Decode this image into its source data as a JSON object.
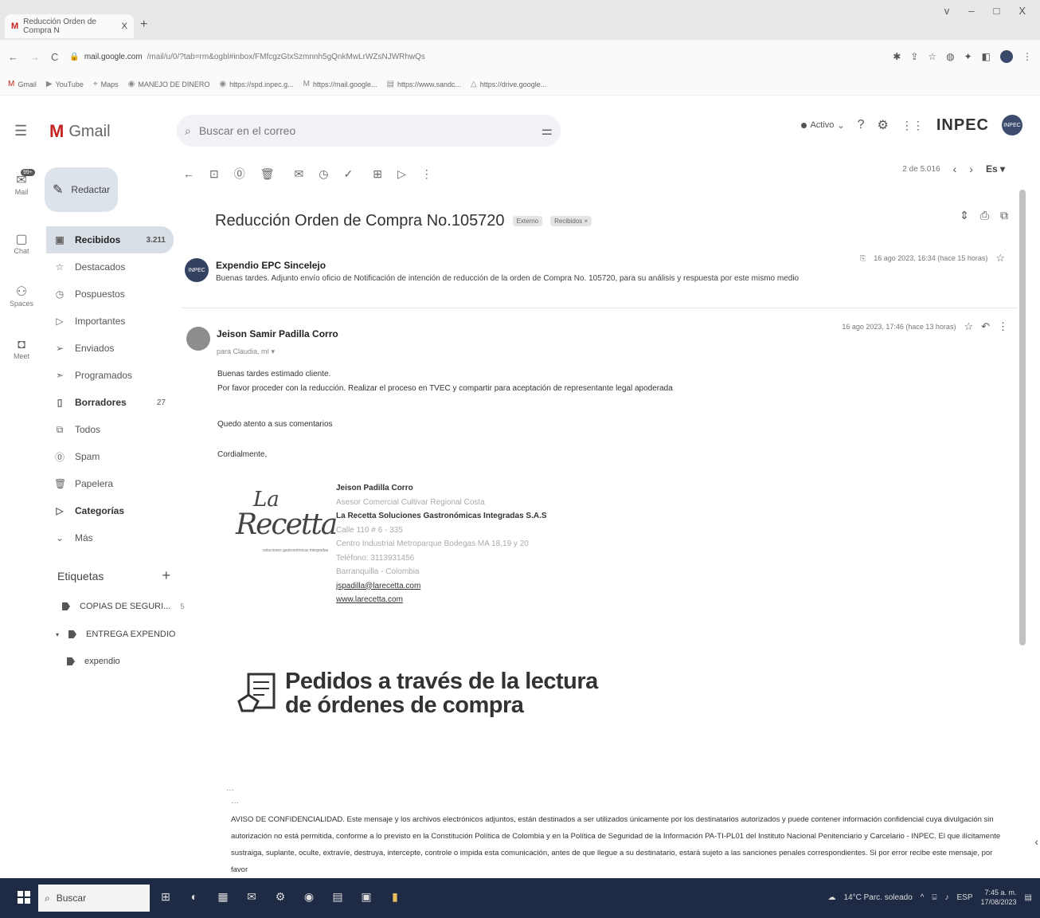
{
  "browser": {
    "tab_title": "Reducción Orden de Compra N",
    "tab_close": "X",
    "new_tab": "+",
    "window_controls": [
      "v",
      "–",
      "□",
      "X"
    ],
    "url_host": "mail.google.com",
    "url_rest": "/mail/u/0/?tab=rm&ogbl#inbox/FMfcgzGtxSzmnnh5gQnkMwLrWZsNJWRhwQs",
    "bookmarks": [
      "Gmail",
      "YouTube",
      "Maps",
      "MANEJO DE DINERO",
      "https://spd.inpec.g...",
      "https://mail.google...",
      "https://www.sandc...",
      "https://drive.google..."
    ]
  },
  "header": {
    "app_name": "Gmail",
    "search_placeholder": "Buscar en el correo",
    "status": "Activo",
    "org_logo": "INPEC"
  },
  "rail": {
    "mail_badge": "99+",
    "items": [
      "Mail",
      "Chat",
      "Spaces",
      "Meet"
    ]
  },
  "sidebar": {
    "compose_label": "Redactar",
    "items": [
      {
        "label": "Recibidos",
        "count": "3.211",
        "icon": "inbox-icon"
      },
      {
        "label": "Destacados",
        "count": "",
        "icon": "star-icon"
      },
      {
        "label": "Pospuestos",
        "count": "",
        "icon": "clock-icon"
      },
      {
        "label": "Importantes",
        "count": "",
        "icon": "important-icon"
      },
      {
        "label": "Enviados",
        "count": "",
        "icon": "send-icon"
      },
      {
        "label": "Programados",
        "count": "",
        "icon": "scheduled-icon"
      },
      {
        "label": "Borradores",
        "count": "27",
        "icon": "draft-icon"
      },
      {
        "label": "Todos",
        "count": "",
        "icon": "all-mail-icon"
      },
      {
        "label": "Spam",
        "count": "",
        "icon": "spam-icon"
      },
      {
        "label": "Papelera",
        "count": "",
        "icon": "trash-icon"
      },
      {
        "label": "Categorías",
        "count": "",
        "icon": "category-icon"
      },
      {
        "label": "Más",
        "count": "",
        "icon": "chevron-down-icon"
      }
    ],
    "labels_heading": "Etiquetas",
    "labels": [
      {
        "label": "COPIAS DE SEGURI...",
        "count": "5"
      },
      {
        "label": "ENTREGA EXPENDIO",
        "count": ""
      },
      {
        "label": "expendio",
        "count": ""
      }
    ]
  },
  "toolbar": {
    "pager_text": "2 de 5.016",
    "lang": "Es"
  },
  "email": {
    "subject": "Reducción Orden de Compra No.105720",
    "chip_external": "Externo",
    "chip_inbox": "Recibidos ×",
    "msg1": {
      "sender": "Expendio EPC Sincelejo",
      "avatar": "INPEC",
      "snippet": "Buenas tardes. Adjunto envío oficio de Notificación de intención de reducción de la orden de Compra No. 105720, para su análisis y respuesta por este mismo medio",
      "time": "16 ago 2023, 16:34 (hace 15 horas)"
    },
    "msg2": {
      "sender": "Jeison Samir Padilla Corro",
      "to": "para Claudia, mí ▾",
      "time": "16 ago 2023, 17:46 (hace 13 horas)",
      "lines": [
        "Buenas tardes estimado cliente.",
        "Por favor proceder con la reducción. Realizar el proceso en TVEC y compartir para aceptación de representante legal apoderada",
        "Quedo atento a sus comentarios",
        "Cordialmente,"
      ]
    },
    "signature": {
      "logo_la": "La",
      "logo_name": "Recetta",
      "logo_tagline": "soluciones gastronómicas integradas",
      "name": "Jeison Padilla Corro",
      "role": "Asesor Comercial Cultivar Regional Costa",
      "company": "La Recetta Soluciones Gastronómicas Integradas S.A.S",
      "address": "Calle 110 # 6 - 335",
      "center": "Centro Industrial Metroparque Bodegas MA 18,19 y 20",
      "phone": "Teléfono: 3113931456",
      "city": "Barranquilla - Colombia",
      "email": "jspadilla@larecetta.com",
      "web": "www.larecetta.com"
    },
    "banner": {
      "line1": "Pedidos a través de la lectura",
      "line2": "de órdenes de compra"
    },
    "notice_html_lines": [
      "AVISO DE CONFIDENCIALIDAD. Este mensaje y los archivos electrónicos adjuntos, están destinados a ser utilizados únicamente por los destinatarios autorizados y puede contener información confidencial cuya divulgación sin",
      "autorización no está permitida, conforme a lo previsto en la Constitución Política de Colombia y en la Política de Seguridad de la Información PA-TI-PL01 del Instituto Nacional Penitenciario y Carcelario - INPEC.  El que ilícitamente",
      "sustraiga, suplante, oculte, extravíe, destruya, intercepte, controle o impida esta comunicación, antes de que llegue a su destinatario, estará sujeto a las sanciones penales correspondientes. Si por error recibe este mensaje, por favor"
    ]
  },
  "taskbar": {
    "search": "Buscar",
    "weather": "14°C Parc. soleado",
    "lang": "ESP",
    "time": "7:45 a. m.",
    "date": "17/08/2023"
  }
}
